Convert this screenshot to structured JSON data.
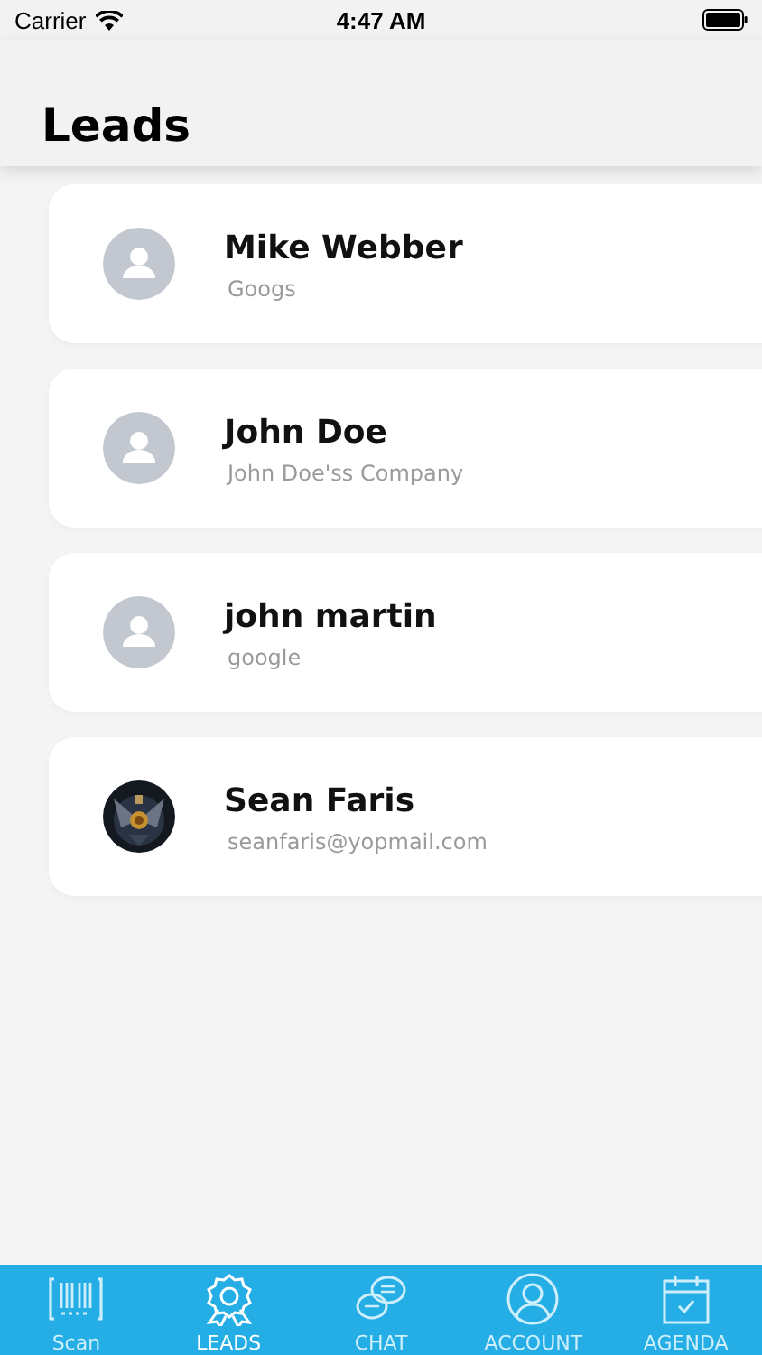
{
  "status_bar": {
    "carrier": "Carrier",
    "time": "4:47 AM"
  },
  "header": {
    "title": "Leads"
  },
  "leads": [
    {
      "name": "Mike Webber",
      "subtitle": "Googs",
      "kind": "placeholder"
    },
    {
      "name": "John Doe",
      "subtitle": "John Doe'ss Company",
      "kind": "placeholder"
    },
    {
      "name": "john martin",
      "subtitle": "google",
      "kind": "placeholder"
    },
    {
      "name": "Sean Faris",
      "subtitle": "seanfaris@yopmail.com",
      "kind": "picture"
    }
  ],
  "tabs": [
    {
      "label": "Scan",
      "kind": "scan",
      "selected": false
    },
    {
      "label": "LEADS",
      "kind": "leads",
      "selected": true
    },
    {
      "label": "CHAT",
      "kind": "chat",
      "selected": false
    },
    {
      "label": "ACCOUNT",
      "kind": "account",
      "selected": false
    },
    {
      "label": "AGENDA",
      "kind": "agenda",
      "selected": false
    }
  ]
}
